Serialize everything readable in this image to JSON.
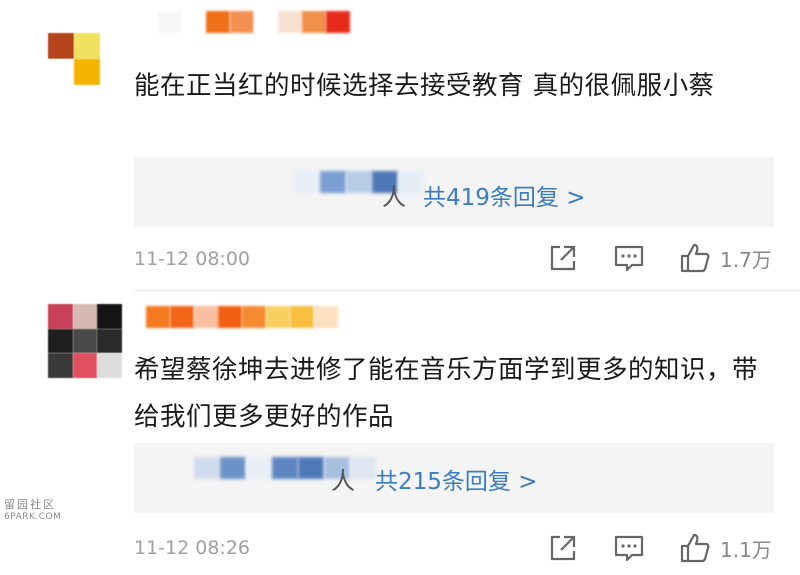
{
  "colors": {
    "link_blue": "#3b7bbf",
    "meta_gray": "#a0a0a0",
    "reply_box_bg": "#f4f4f4"
  },
  "comments": [
    {
      "avatar_pixels": [
        "#b5441c",
        "#f0e060",
        "#ffffff",
        "#f3b400"
      ],
      "username_pixels": [
        "#ffffff",
        "#f7f7f7",
        "#ffffff",
        "#f07018",
        "#f59050",
        "#ffffff",
        "#f8e0d0",
        "#f0904a",
        "#e82a1a"
      ],
      "text": "能在正当红的时候选择去接受教育 真的很佩服小蔡",
      "reply_name_pixels": [
        "#e8eef6",
        "#7a9fd0",
        "#b8cce6",
        "#4e77b8",
        "#e6ecf5"
      ],
      "reply_suffix": "人",
      "reply_count_label": "共419条回复 >",
      "time": "11-12 08:00",
      "like_count": "1.7万",
      "icons": [
        "share-icon",
        "comment-icon",
        "like-icon"
      ]
    },
    {
      "avatar_pixels": [
        "#c8405a",
        "#d6b9b0",
        "#151515",
        "#1f1f1f",
        "#4a4a4a",
        "#2a2a2a",
        "#3a3a3a",
        "#e05060",
        "#dcdcdc"
      ],
      "username_pixels": [
        "#f57a20",
        "#f26418",
        "#f8c0a0",
        "#f06010",
        "#f58a30",
        "#f8d060",
        "#f9c040",
        "#fde0c0"
      ],
      "text": "希望蔡徐坤去进修了能在音乐方面学到更多的知识，带给我们更多更好的作品",
      "reply_name_pixels": [
        "#d0dcec",
        "#6c93c8",
        "#e8eef6",
        "#5d85c0",
        "#4f78b8",
        "#a8c0e0",
        "#dfe7f2"
      ],
      "reply_suffix": "人",
      "reply_count_label": "共215条回复 >",
      "time": "11-12 08:26",
      "like_count": "1.1万",
      "icons": [
        "share-icon",
        "comment-icon",
        "like-icon"
      ]
    }
  ],
  "watermark": {
    "line1": "留园社区",
    "line2": "6PARK.COM"
  }
}
